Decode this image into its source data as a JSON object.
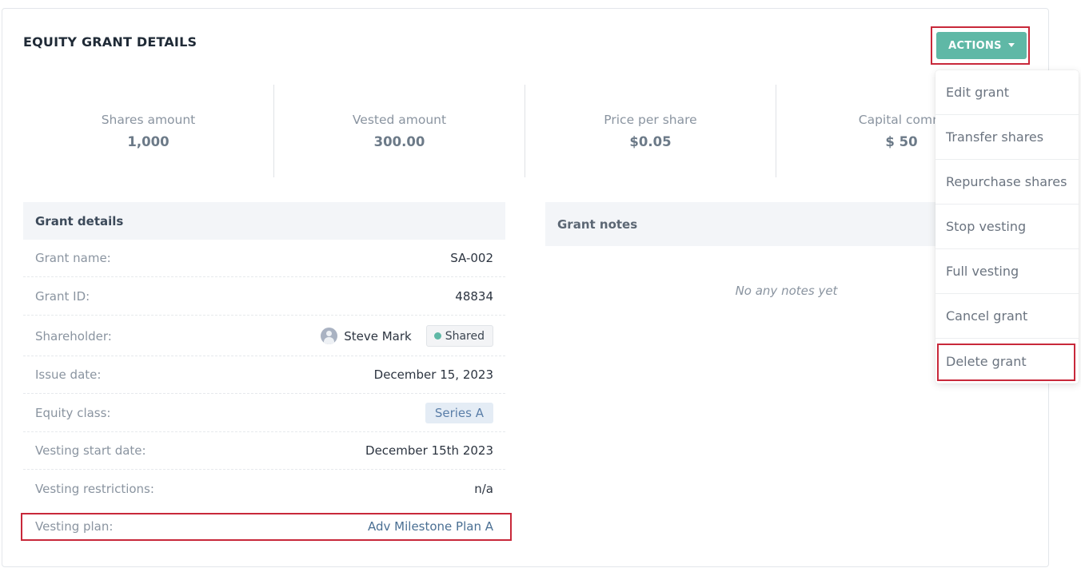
{
  "header": {
    "title": "EQUITY GRANT DETAILS"
  },
  "actions": {
    "button_label": "ACTIONS",
    "menu": [
      "Edit grant",
      "Transfer shares",
      "Repurchase shares",
      "Stop vesting",
      "Full vesting",
      "Cancel grant",
      "Delete grant"
    ]
  },
  "stats": [
    {
      "label": "Shares amount",
      "value": "1,000"
    },
    {
      "label": "Vested amount",
      "value": "300.00"
    },
    {
      "label": "Price per share",
      "value": "$0.05"
    },
    {
      "label": "Capital comm",
      "value": "$ 50"
    }
  ],
  "grant_details": {
    "title": "Grant details",
    "rows": [
      {
        "label": "Grant name:",
        "value": "SA-002"
      },
      {
        "label": "Grant ID:",
        "value": "48834"
      },
      {
        "label": "Shareholder:",
        "value": "Steve Mark",
        "badge": "Shared"
      },
      {
        "label": "Issue date:",
        "value": "December 15, 2023"
      },
      {
        "label": "Equity class:",
        "value": "Series A"
      },
      {
        "label": "Vesting start date:",
        "value": "December 15th 2023"
      },
      {
        "label": "Vesting restrictions:",
        "value": "n/a"
      },
      {
        "label": "Vesting plan:",
        "value": "Adv Milestone Plan A"
      }
    ]
  },
  "grant_notes": {
    "title": "Grant notes",
    "empty_text": "No any notes yet"
  },
  "colors": {
    "accent": "#5fb8a6",
    "highlight": "#c8283a",
    "link": "#4a6f93"
  }
}
